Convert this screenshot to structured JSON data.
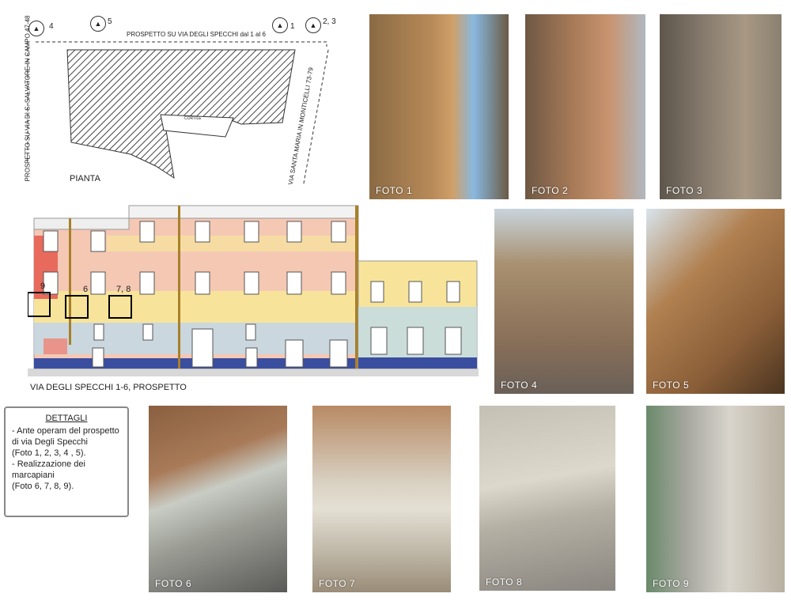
{
  "plan": {
    "label_pianta": "PIANTA",
    "top_label": "PROSPETTO SU VIA DEGLI SPECCHI dal 1 al 6",
    "left_label": "PROSPETTO SU VIA DI S. SALVATORE IN CAMPO 47-48",
    "right_label": "VIA SANTA MARIA IN MONTICELLI 73-79",
    "courtyard": "CORTILE",
    "markers": [
      "4",
      "5",
      "1",
      "2, 3"
    ]
  },
  "elevation": {
    "caption": "VIA DEGLI SPECCHI 1-6, PROSPETTO",
    "detail_markers": [
      "9",
      "6",
      "7, 8"
    ]
  },
  "details": {
    "heading": "DETTAGLI",
    "lines": [
      "- Ante operam del prospetto",
      "di via Degli Specchi",
      "(Foto 1, 2, 3, 4 , 5).",
      "- Realizzazione dei marcapiani",
      "(Foto 6, 7, 8, 9)."
    ]
  },
  "photos": [
    "FOTO 1",
    "FOTO 2",
    "FOTO 3",
    "FOTO 4",
    "FOTO 5",
    "FOTO 6",
    "FOTO 7",
    "FOTO 8",
    "FOTO 9"
  ]
}
